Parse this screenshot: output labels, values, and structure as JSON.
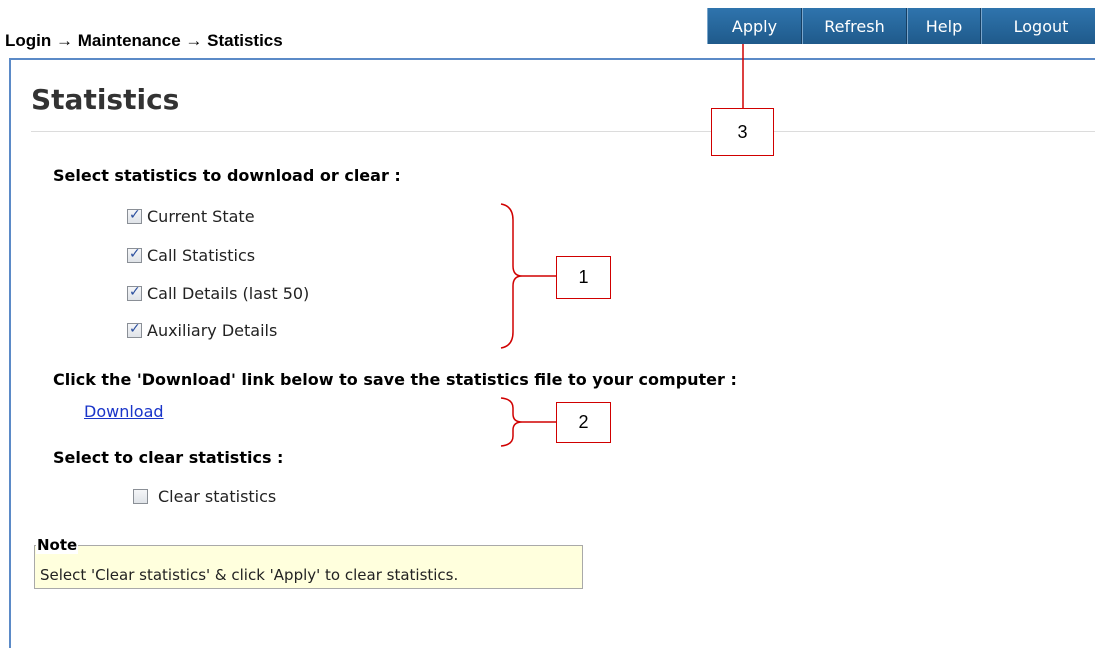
{
  "breadcrumb": "Login → Maintenance → Statistics",
  "toolbar": {
    "apply": "Apply",
    "refresh": "Refresh",
    "help": "Help",
    "logout": "Logout"
  },
  "page_title": "Statistics",
  "select_heading": "Select statistics to download or clear :",
  "stats_options": [
    {
      "label": "Current State",
      "checked": true
    },
    {
      "label": "Call Statistics",
      "checked": true
    },
    {
      "label": "Call Details (last 50)",
      "checked": true
    },
    {
      "label": "Auxiliary Details",
      "checked": true
    }
  ],
  "download_heading": "Click the 'Download' link below to save the statistics file to your computer :",
  "download_link": "Download",
  "clear_heading": "Select to clear statistics :",
  "clear_option": {
    "label": "Clear statistics",
    "checked": false
  },
  "note": {
    "legend": "Note",
    "text": "Select 'Clear statistics' & click 'Apply' to clear statistics."
  },
  "callouts": {
    "one": "1",
    "two": "2",
    "three": "3"
  },
  "colors": {
    "toolbar": "#235e8f",
    "panel_border": "#5b8ac7",
    "callout": "#d00000",
    "note_bg": "#ffffdd",
    "link": "#1a35c9"
  }
}
